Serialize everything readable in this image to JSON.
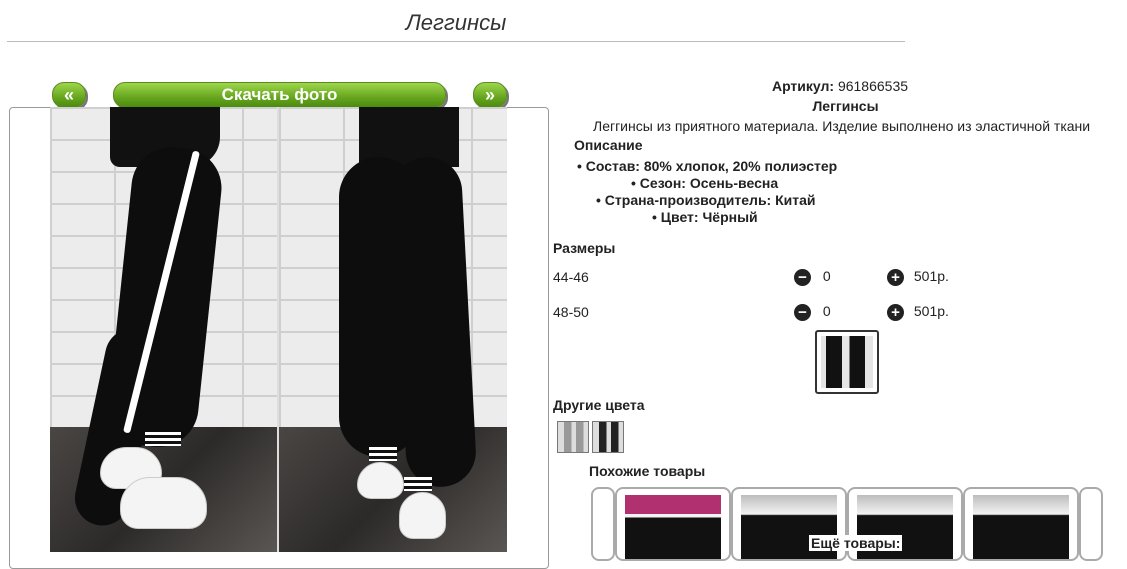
{
  "page": {
    "title": "Леггинсы"
  },
  "gallery": {
    "prev_label": "«",
    "next_label": "»",
    "download_label": "Скачать фото"
  },
  "product": {
    "article_label": "Артикул:",
    "article_value": "961866535",
    "name": "Леггинсы",
    "summary": "Леггинсы из приятного материала. Изделие выполнено из эластичной ткани",
    "description_heading": "Описание",
    "specs": [
      "Состав: 80% хлопок, 20% полиэстер",
      "Сезон: Осень-весна",
      "Страна-производитель: Китай",
      "Цвет: Чёрный"
    ]
  },
  "sizes": {
    "heading": "Размеры",
    "rows": [
      {
        "size": "44-46",
        "qty": "0",
        "price": "501р."
      },
      {
        "size": "48-50",
        "qty": "0",
        "price": "501р."
      }
    ],
    "minus_icon": "minus-circle-icon",
    "plus_icon": "plus-circle-icon"
  },
  "other_colors": {
    "heading": "Другие цвета"
  },
  "similar": {
    "heading": "Похожие товары",
    "more_label": "Ещё товары:"
  }
}
